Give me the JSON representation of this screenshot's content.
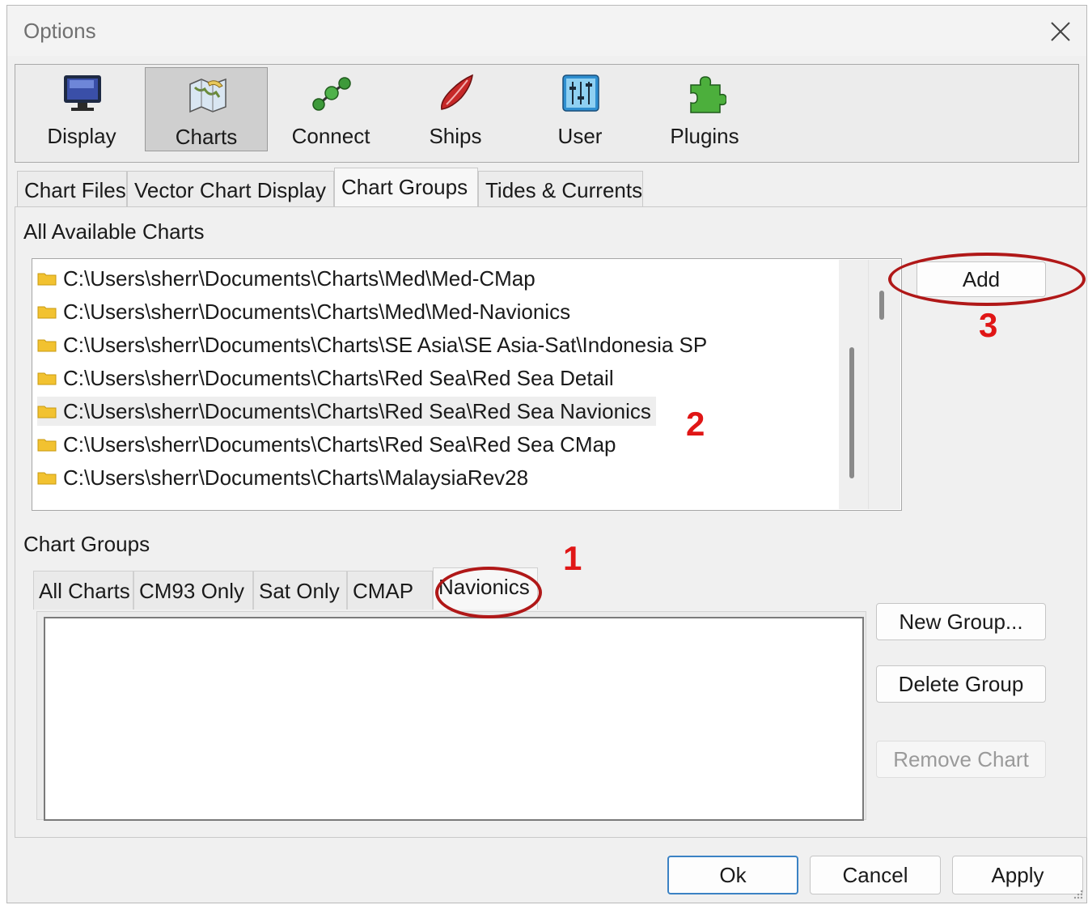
{
  "window": {
    "title": "Options"
  },
  "toolbar": {
    "items": [
      {
        "label": "Display",
        "icon": "monitor-icon"
      },
      {
        "label": "Charts",
        "icon": "chart-map-icon",
        "selected": true
      },
      {
        "label": "Connect",
        "icon": "network-nodes-icon"
      },
      {
        "label": "Ships",
        "icon": "ship-icon"
      },
      {
        "label": "User",
        "icon": "sliders-icon"
      },
      {
        "label": "Plugins",
        "icon": "puzzle-icon"
      }
    ]
  },
  "tabs": [
    {
      "label": "Chart Files"
    },
    {
      "label": "Vector Chart Display"
    },
    {
      "label": "Chart Groups",
      "active": true
    },
    {
      "label": "Tides & Currents"
    }
  ],
  "available": {
    "label": "All Available Charts",
    "items": [
      "C:\\Users\\sherr\\Documents\\Charts\\Med\\Med-CMap",
      "C:\\Users\\sherr\\Documents\\Charts\\Med\\Med-Navionics",
      "C:\\Users\\sherr\\Documents\\Charts\\SE Asia\\SE Asia-Sat\\Indonesia SP",
      "C:\\Users\\sherr\\Documents\\Charts\\Red Sea\\Red Sea Detail",
      "C:\\Users\\sherr\\Documents\\Charts\\Red Sea\\Red Sea Navionics",
      "C:\\Users\\sherr\\Documents\\Charts\\Red Sea\\Red Sea CMap",
      "C:\\Users\\sherr\\Documents\\Charts\\MalaysiaRev28"
    ],
    "selected_index": 4,
    "add_label": "Add"
  },
  "groups": {
    "label": "Chart Groups",
    "tabs": [
      "All Charts",
      "CM93 Only",
      "Sat Only",
      "CMAP",
      "Navionics"
    ],
    "active_index": 4,
    "new_group_label": "New Group...",
    "delete_group_label": "Delete Group",
    "remove_chart_label": "Remove Chart"
  },
  "footer": {
    "ok_label": "Ok",
    "cancel_label": "Cancel",
    "apply_label": "Apply"
  },
  "annotations": {
    "a1": "1",
    "a2": "2",
    "a3": "3"
  },
  "colors": {
    "annotation_text": "#e01616",
    "annotation_ring": "#b01818",
    "primary_border": "#3b82c4"
  }
}
